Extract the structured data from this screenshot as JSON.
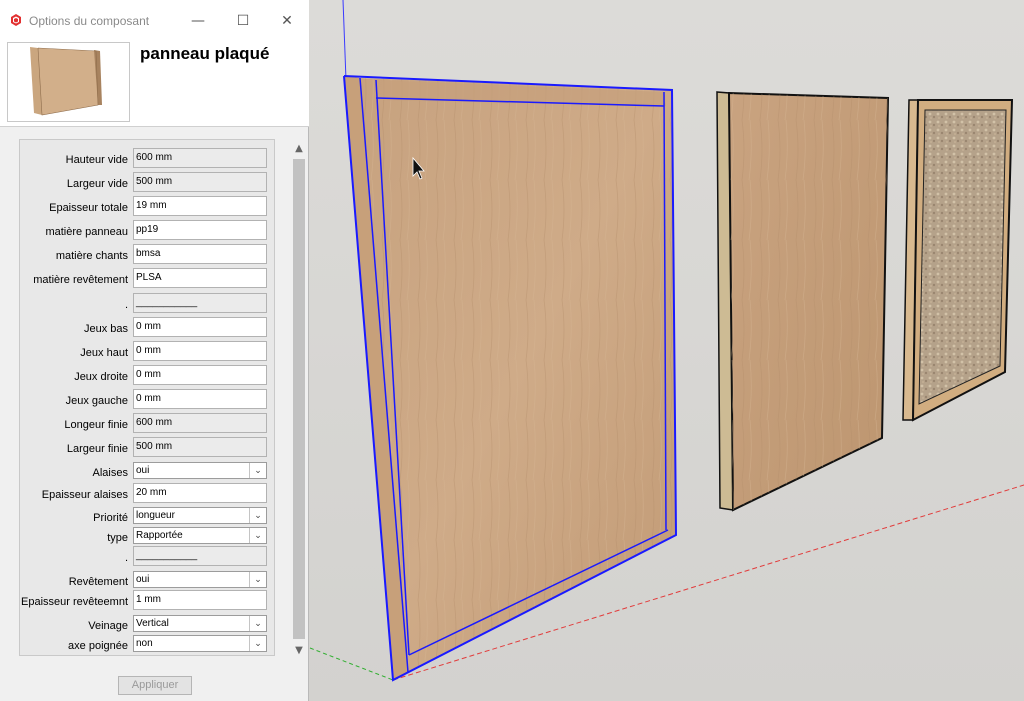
{
  "window": {
    "title": "Options du composant",
    "minimize_glyph": "—",
    "maximize_glyph": "☐",
    "close_glyph": "✕"
  },
  "component": {
    "name": "panneau plaqué"
  },
  "fields": [
    {
      "label": "Hauteur vide",
      "value": "600 mm",
      "kind": "readonly"
    },
    {
      "label": "Largeur vide",
      "value": "500 mm",
      "kind": "readonly"
    },
    {
      "label": "Epaisseur totale",
      "value": "19 mm",
      "kind": "text"
    },
    {
      "label": "matière panneau",
      "value": "pp19",
      "kind": "text"
    },
    {
      "label": "matière chants",
      "value": "bmsa",
      "kind": "text"
    },
    {
      "label": "matière revêtement",
      "value": "PLSA",
      "kind": "text"
    },
    {
      "label": ".",
      "value": "___________",
      "kind": "readonly"
    },
    {
      "label": "Jeux bas",
      "value": "0 mm",
      "kind": "text"
    },
    {
      "label": "Jeux haut",
      "value": "0 mm",
      "kind": "text"
    },
    {
      "label": "Jeux droite",
      "value": "0 mm",
      "kind": "text"
    },
    {
      "label": "Jeux gauche",
      "value": "0 mm",
      "kind": "text"
    },
    {
      "label": "Longeur finie",
      "value": "600 mm",
      "kind": "readonly"
    },
    {
      "label": "Largeur finie",
      "value": "500 mm",
      "kind": "readonly"
    },
    {
      "label": "Alaises",
      "value": "oui",
      "kind": "select"
    },
    {
      "label": "Epaisseur alaises",
      "value": "20 mm",
      "kind": "text"
    },
    {
      "label": "Priorité",
      "value": "longueur",
      "kind": "select"
    },
    {
      "label": "type",
      "value": "Rapportée",
      "kind": "select"
    },
    {
      "label": ".",
      "value": "___________",
      "kind": "readonly"
    },
    {
      "label": "Revêtement",
      "value": "oui",
      "kind": "select"
    },
    {
      "label": "Epaisseur revêteemnt",
      "value": "1 mm",
      "kind": "text"
    },
    {
      "label": "Veinage",
      "value": "Vertical",
      "kind": "select"
    },
    {
      "label": "axe poignée",
      "value": "non",
      "kind": "select"
    }
  ],
  "actions": {
    "apply_label": "Appliquer"
  },
  "colors": {
    "selection": "#1a1aff",
    "wood": "#c9a27c",
    "dialog_bg": "#f0f0f0"
  }
}
